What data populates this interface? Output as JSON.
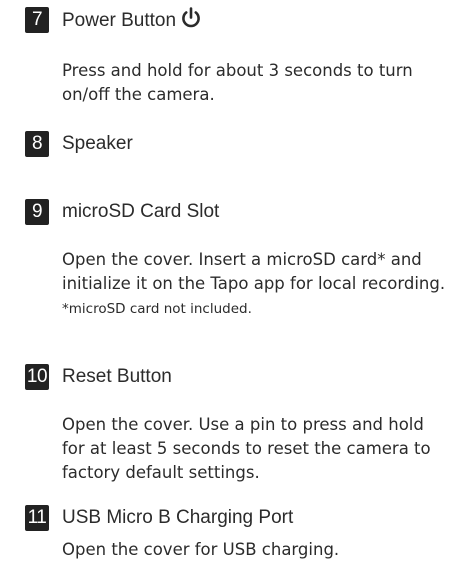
{
  "items": [
    {
      "number": "7",
      "title": "Power Button",
      "icon": "power-icon",
      "description": "Press and hold for about 3 seconds to turn on/off the camera."
    },
    {
      "number": "8",
      "title": "Speaker"
    },
    {
      "number": "9",
      "title": "microSD Card Slot",
      "description": "Open the cover. Insert a microSD card* and initialize it on the Tapo app for local recording.",
      "note": "*microSD card not included."
    },
    {
      "number": "10",
      "title": "Reset Button",
      "description": "Open the cover. Use a pin to press and hold for at least 5 seconds to reset the camera to factory default settings."
    },
    {
      "number": "11",
      "title": "USB Micro B Charging Port",
      "description": "Open the cover for USB charging."
    }
  ]
}
